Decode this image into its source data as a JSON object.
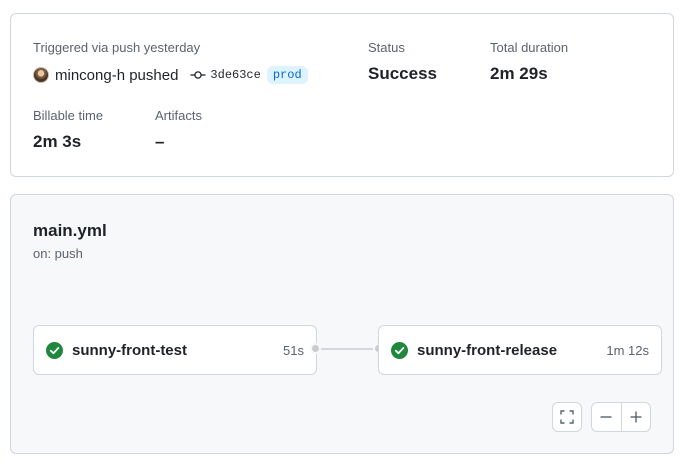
{
  "summary": {
    "trigger_text": "Triggered via push yesterday",
    "actor_text": "mincong-h pushed",
    "commit_sha": "3de63ce",
    "branch": "prod",
    "status_label": "Status",
    "status_value": "Success",
    "duration_label": "Total duration",
    "duration_value": "2m 29s",
    "billable_label": "Billable time",
    "billable_value": "2m 3s",
    "artifacts_label": "Artifacts",
    "artifacts_value": "–"
  },
  "workflow": {
    "file_name": "main.yml",
    "trigger": "on: push",
    "jobs": [
      {
        "name": "sunny-front-test",
        "duration": "51s",
        "status": "success"
      },
      {
        "name": "sunny-front-release",
        "duration": "1m 12s",
        "status": "success"
      }
    ]
  },
  "controls": {
    "icons": [
      "fullscreen-icon",
      "zoom-out-icon",
      "zoom-in-icon"
    ]
  },
  "colors": {
    "success": "#1f883d",
    "link": "#0969da",
    "branch_bg": "#ddf4ff",
    "panel_bg": "#f6f8fa",
    "border": "#d0d7de"
  }
}
